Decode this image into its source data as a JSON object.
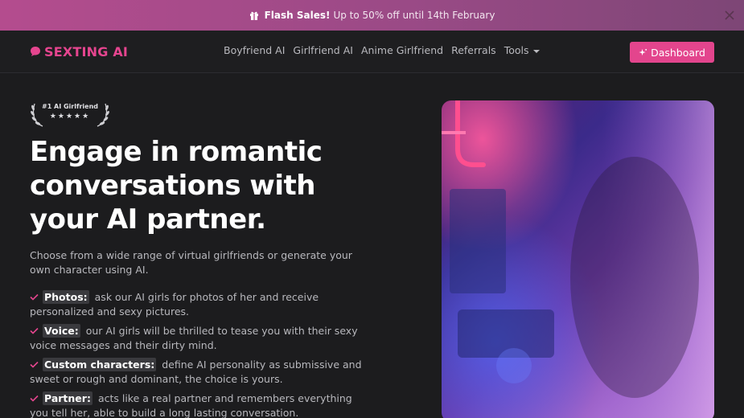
{
  "promo": {
    "strong": "Flash Sales!",
    "text": "Up to 50% off until 14th February"
  },
  "brand": {
    "name": "SEXTING AI"
  },
  "nav": {
    "items": [
      "Boyfriend AI",
      "Girlfriend AI",
      "Anime Girlfriend",
      "Referrals",
      "Tools"
    ],
    "dashboard_label": "Dashboard"
  },
  "badge": {
    "title": "#1 AI Girlfriend",
    "stars": "★★★★★"
  },
  "hero": {
    "headline": "Engage in romantic conversations with your AI partner.",
    "subtitle": "Choose from a wide range of virtual girlfriends or generate your own character using AI."
  },
  "features": [
    {
      "tag": "Photos:",
      "text": "ask our AI girls for photos of her and receive personalized and sexy pictures."
    },
    {
      "tag": "Voice:",
      "text": "our AI girls will be thrilled to tease you with their sexy voice messages and their dirty mind."
    },
    {
      "tag": "Custom characters:",
      "text": "define AI personality as submissive and sweet or rough and dominant, the choice is yours."
    },
    {
      "tag": "Partner:",
      "text": "acts like a real partner and remembers everything you tell her, able to build a long lasting conversation."
    }
  ],
  "colors": {
    "accent": "#e3458d",
    "background": "#1c1c1e",
    "banner": "#b44c8e"
  }
}
